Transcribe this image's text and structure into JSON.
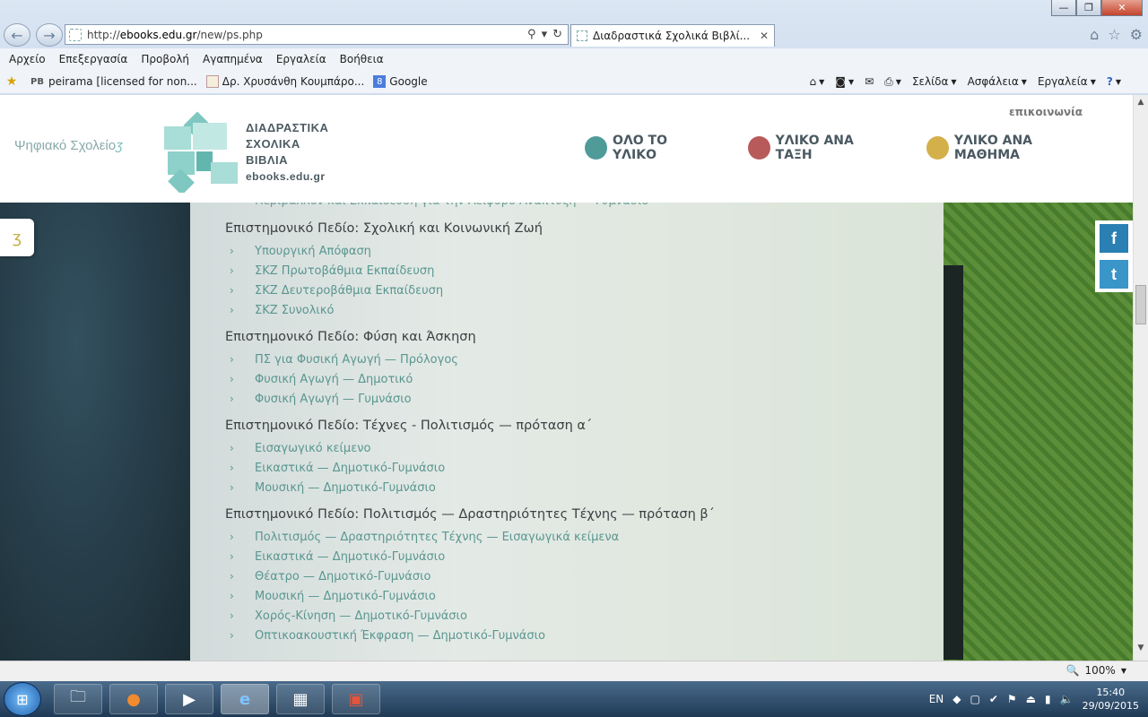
{
  "browser": {
    "url_prefix": "http://",
    "url_host": "ebooks.edu.gr",
    "url_path": "/new/ps.php",
    "tab_title": "Διαδραστικά Σχολικά Βιβλί...",
    "menu": [
      "Αρχείο",
      "Επεξεργασία",
      "Προβολή",
      "Αγαπημένα",
      "Εργαλεία",
      "Βοήθεια"
    ],
    "favorites": [
      {
        "label": "peirama [licensed for non...",
        "icon": "pb-icon"
      },
      {
        "label": "Δρ. Χρυσάνθη Κουμπάρο...",
        "icon": "page-icon"
      },
      {
        "label": "Google",
        "icon": "google-icon"
      }
    ],
    "favorites_prefix": "PB",
    "commands": {
      "page": "Σελίδα",
      "safety": "Ασφάλεια",
      "tools": "Εργαλεία"
    },
    "zoom": "100%"
  },
  "site": {
    "ps_logo": "Ψηφιακό Σχολείο",
    "logo_lines": [
      "ΔΙΑΔΡΑΣΤΙΚΑ",
      "ΣΧΟΛΙΚΑ",
      "ΒΙΒΛΙΑ"
    ],
    "logo_domain": "ebooks.edu.gr",
    "contact": "επικοινωνία",
    "nav": [
      {
        "label": "ΟΛΟ ΤΟ ΥΛΙΚΟ",
        "color": "#4f9b9a"
      },
      {
        "label": "ΥΛΙΚΟ ΑΝΑ ΤΑΞΗ",
        "color": "#b85a5a"
      },
      {
        "label": "ΥΛΙΚΟ ΑΝΑ ΜΑΘΗΜΑ",
        "color": "#d3b04a"
      }
    ]
  },
  "content": {
    "cut_link": "Περιβάλλον και Εκπαίδευση για την Αειφόρο Ανάπτυξη — Γυμνάσιο",
    "sections": [
      {
        "title": "Επιστημονικό Πεδίο: Σχολική και Κοινωνική Ζωή",
        "items": [
          "Υπουργική Απόφαση",
          "ΣΚΖ Πρωτοβάθμια Εκπαίδευση",
          "ΣΚΖ Δευτεροβάθμια Εκπαίδευση",
          "ΣΚΖ Συνολικό"
        ]
      },
      {
        "title": "Επιστημονικό Πεδίο: Φύση και Άσκηση",
        "items": [
          "ΠΣ για Φυσική Αγωγή — Πρόλογος",
          "Φυσική Αγωγή — Δημοτικό",
          "Φυσική Αγωγή — Γυμνάσιο"
        ]
      },
      {
        "title": "Επιστημονικό Πεδίο: Τέχνες - Πολιτισμός — πρόταση α΄",
        "items": [
          "Εισαγωγικό κείμενο",
          "Εικαστικά — Δημοτικό-Γυμνάσιο",
          "Μουσική — Δημοτικό-Γυμνάσιο"
        ]
      },
      {
        "title": "Επιστημονικό Πεδίο: Πολιτισμός — Δραστηριότητες Τέχνης — πρόταση β΄",
        "items": [
          "Πολιτισμός — Δραστηριότητες Τέχνης — Εισαγωγικά κείμενα",
          "Εικαστικά — Δημοτικό-Γυμνάσιο",
          "Θέατρο — Δημοτικό-Γυμνάσιο",
          "Μουσική — Δημοτικό-Γυμνάσιο",
          "Χορός-Κίνηση — Δημοτικό-Γυμνάσιο",
          "Οπτικοακουστική Έκφραση — Δημοτικό-Γυμνάσιο"
        ]
      }
    ]
  },
  "taskbar": {
    "lang": "EN",
    "time": "15:40",
    "date": "29/09/2015"
  }
}
